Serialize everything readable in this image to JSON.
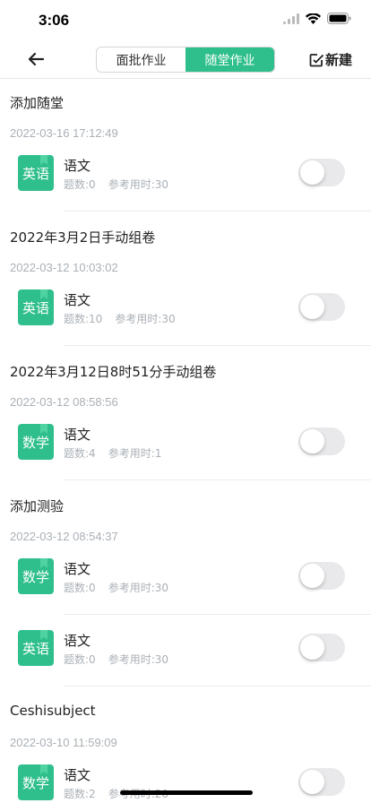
{
  "status": {
    "time": "3:06"
  },
  "nav": {
    "back_label": "",
    "tabs": [
      "面批作业",
      "随堂作业"
    ],
    "active_tab": 1,
    "new_label": "新建"
  },
  "groups": [
    {
      "title": "添加随堂",
      "date": "2022-03-16 17:12:49",
      "items": [
        {
          "badge": "英语",
          "title": "语文",
          "count": "题数:0",
          "time": "参考用时:30"
        }
      ]
    },
    {
      "title": "2022年3月2日手动组卷",
      "date": "2022-03-12 10:03:02",
      "items": [
        {
          "badge": "英语",
          "title": "语文",
          "count": "题数:10",
          "time": "参考用时:30"
        }
      ]
    },
    {
      "title": "2022年3月12日8时51分手动组卷",
      "date": "2022-03-12 08:58:56",
      "items": [
        {
          "badge": "数学",
          "title": "语文",
          "count": "题数:4",
          "time": "参考用时:1"
        }
      ]
    },
    {
      "title": "添加测验",
      "date": "2022-03-12 08:54:37",
      "items": [
        {
          "badge": "数学",
          "title": "语文",
          "count": "题数:0",
          "time": "参考用时:30"
        },
        {
          "badge": "英语",
          "title": "语文",
          "count": "题数:0",
          "time": "参考用时:30"
        }
      ]
    },
    {
      "title": "Ceshisubject",
      "date": "2022-03-10 11:59:09",
      "items": [
        {
          "badge": "数学",
          "title": "语文",
          "count": "题数:2",
          "time": "参考用时:20"
        }
      ]
    }
  ]
}
